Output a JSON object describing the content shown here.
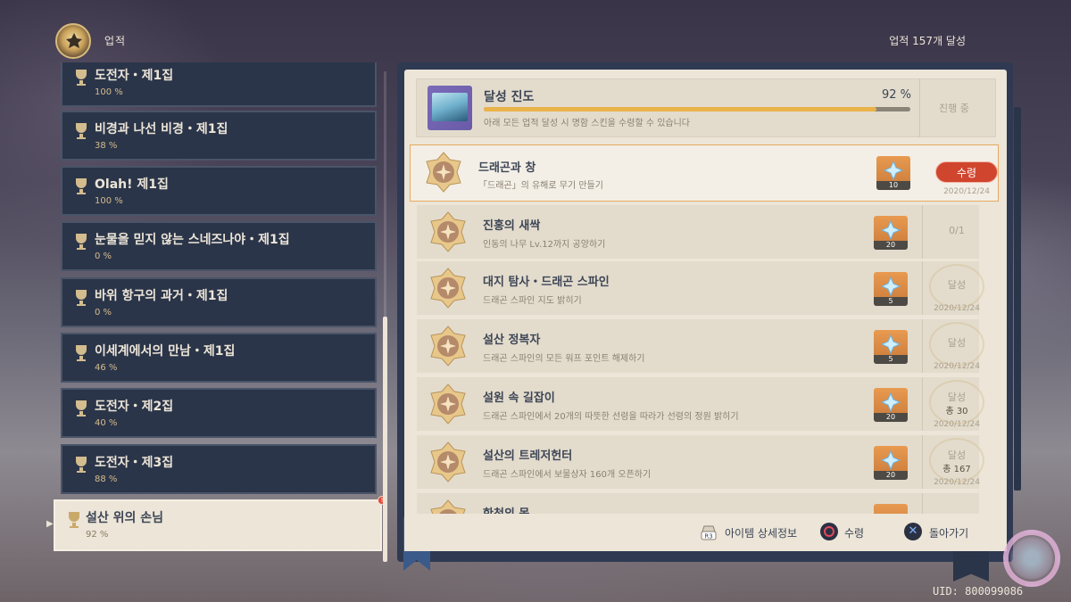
{
  "header": {
    "title": "업적",
    "achievement_count": "업적 157개 달성"
  },
  "categories": [
    {
      "name": "도전자・제1집",
      "percent": "100 %"
    },
    {
      "name": "비경과 나선 비경・제1집",
      "percent": "38 %"
    },
    {
      "name": "Olah! 제1집",
      "percent": "100 %"
    },
    {
      "name": "눈물을 믿지 않는 스네즈나야・제1집",
      "percent": "0 %"
    },
    {
      "name": "바위 항구의 과거・제1집",
      "percent": "0 %"
    },
    {
      "name": "이세계에서의 만남・제1집",
      "percent": "46 %"
    },
    {
      "name": "도전자・제2집",
      "percent": "40 %"
    },
    {
      "name": "도전자・제3집",
      "percent": "88 %"
    },
    {
      "name": "설산 위의 손님",
      "percent": "92 %",
      "selected": true
    }
  ],
  "progress": {
    "title": "달성 진도",
    "percent_label": "92 %",
    "percent_value": 92,
    "description": "아래 모든 업적 달성 시 명함 스킨을 수령할 수 있습니다",
    "status": "진행 중"
  },
  "achievements": [
    {
      "name": "드래곤과 창",
      "desc": "「드래곤」의 유해로 무기 만들기",
      "reward": "10",
      "action": "수령",
      "date": "2020/12/24",
      "active": true
    },
    {
      "name": "진홍의 새싹",
      "desc": "인동의 나무 Lv.12까지 공양하기",
      "reward": "20",
      "status": "0/1"
    },
    {
      "name": "대지 탐사・드래곤 스파인",
      "desc": "드래곤 스파인 지도 밝히기",
      "reward": "5",
      "status": "달성",
      "date": "2020/12/24"
    },
    {
      "name": "설산 정복자",
      "desc": "드래곤 스파인의 모든 워프 포인트 해제하기",
      "reward": "5",
      "status": "달성",
      "date": "2020/12/24"
    },
    {
      "name": "설원 속 길잡이",
      "desc": "드래곤 스파인에서 20개의 따뜻한 선령을 따라가 선령의 정원 밝히기",
      "reward": "20",
      "status": "달성",
      "total": "총 30",
      "date": "2020/12/24"
    },
    {
      "name": "설산의 트레저헌터",
      "desc": "드래곤 스파인에서 보물상자 160개 오픈하기",
      "reward": "20",
      "status": "달성",
      "total": "총 167",
      "date": "2020/12/24"
    },
    {
      "name": "한천의 못",
      "desc": "",
      "reward": ""
    }
  ],
  "footer": {
    "item_detail_key": "R3",
    "item_detail": "아이템 상세정보",
    "claim": "수령",
    "back": "돌아가기"
  },
  "uid": "UID: 800099086",
  "colors": {
    "panel_bg": "#ece5d8",
    "list_item_bg": "#2b3549",
    "progress_fill": "#e9b34a",
    "claim_button": "#d0452e",
    "reward_bg": "#c97a3a"
  }
}
